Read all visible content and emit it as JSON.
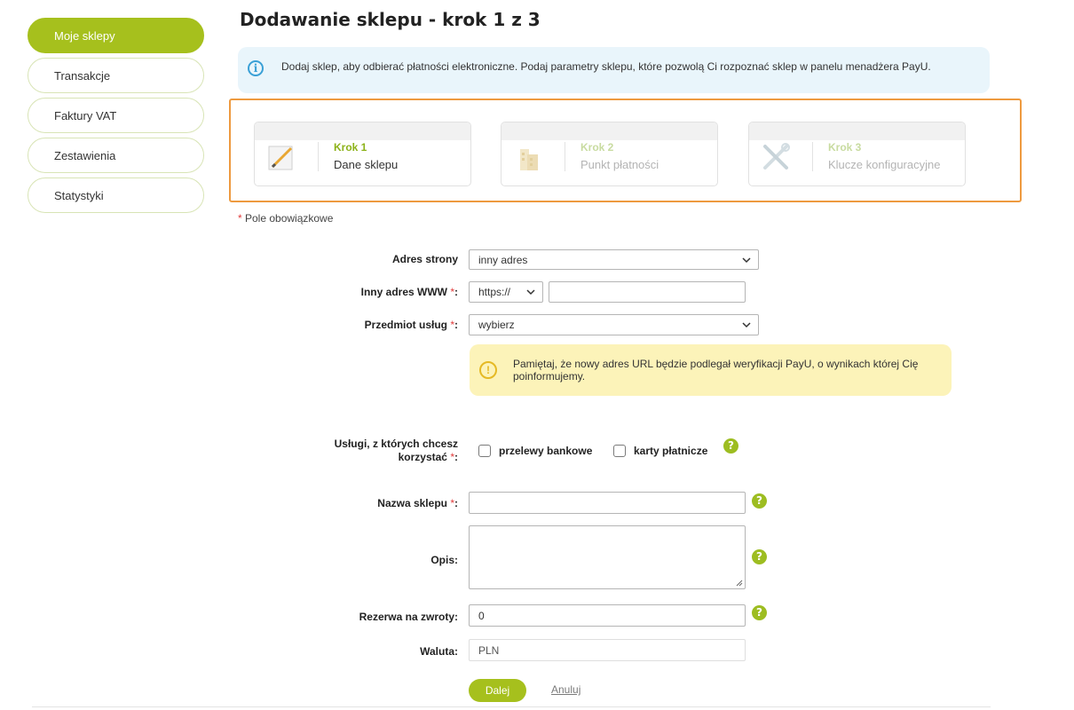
{
  "sidebar": {
    "items": [
      {
        "label": "Moje sklepy",
        "active": true
      },
      {
        "label": "Transakcje"
      },
      {
        "label": "Faktury VAT"
      },
      {
        "label": "Zestawienia"
      },
      {
        "label": "Statystyki"
      }
    ]
  },
  "page": {
    "title": "Dodawanie sklepu - krok 1 z 3"
  },
  "info": {
    "text": "Dodaj sklep, aby odbierać płatności elektroniczne. Podaj parametry sklepu, które pozwolą Ci rozpoznać sklep w panelu menadżera PayU."
  },
  "steps": [
    {
      "number": "Krok 1",
      "name": "Dane sklepu",
      "icon": "pencil-icon",
      "state": "current"
    },
    {
      "number": "Krok 2",
      "name": "Punkt płatności",
      "icon": "building-icon",
      "state": "inactive"
    },
    {
      "number": "Krok 3",
      "name": "Klucze konfiguracyjne",
      "icon": "tools-icon",
      "state": "inactive"
    }
  ],
  "required_note": {
    "star": "*",
    "text": " Pole obowiązkowe"
  },
  "form": {
    "address": {
      "label": "Adres strony",
      "value": "inny adres"
    },
    "www": {
      "label": "Inny adres WWW",
      "req": " *",
      "colon": ":",
      "protocol": "https://",
      "value": ""
    },
    "subject": {
      "label": "Przedmiot usług",
      "req": " *",
      "colon": ":",
      "value": "wybierz"
    },
    "warning": {
      "text": "Pamiętaj, że nowy adres URL będzie podlegał weryfikacji PayU, o wynikach której Cię poinformujemy."
    },
    "services": {
      "label_line1": "Usługi, z których chcesz",
      "label_line2": "korzystać",
      "req": " *",
      "colon": ":",
      "options": [
        {
          "label": "przelewy bankowe",
          "checked": false
        },
        {
          "label": "karty płatnicze",
          "checked": false
        }
      ]
    },
    "shop_name": {
      "label": "Nazwa sklepu",
      "req": " *",
      "colon": ":",
      "value": ""
    },
    "description": {
      "label": "Opis:",
      "value": ""
    },
    "refund_reserve": {
      "label": "Rezerwa na zwroty:",
      "value": "0"
    },
    "currency": {
      "label": "Waluta:",
      "value": "PLN"
    }
  },
  "actions": {
    "next": "Dalej",
    "cancel": "Anuluj"
  },
  "help": {
    "glyph": "?"
  },
  "info_glyph": "i",
  "warn_glyph": "!",
  "colors": {
    "accent": "#a6c01d",
    "highlight_frame": "#ee9a3f",
    "info_bg": "#e9f5fb",
    "warn_bg": "#fcf3b9",
    "required": "#e03a3a"
  }
}
